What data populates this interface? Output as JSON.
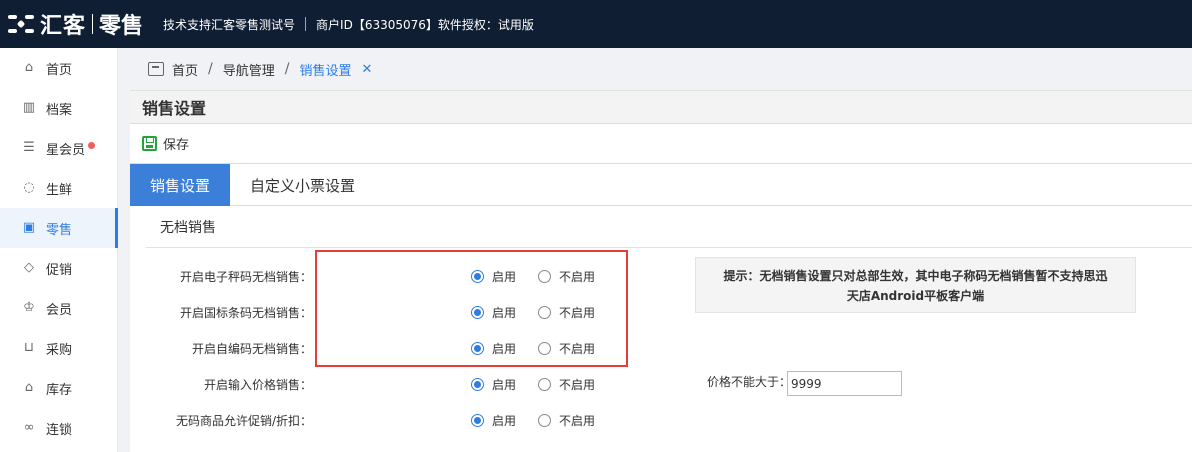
{
  "topbar": {
    "brand": "汇客",
    "product": "零售",
    "support": "技术支持汇客零售测试号",
    "merchant": "商户ID【63305076】软件授权：试用版"
  },
  "sidebar": {
    "items": [
      {
        "label": "首页",
        "icon": "home-icon"
      },
      {
        "label": "档案",
        "icon": "archive-icon"
      },
      {
        "label": "星会员",
        "icon": "star-member-icon",
        "badge": true
      },
      {
        "label": "生鲜",
        "icon": "apple-icon"
      },
      {
        "label": "零售",
        "icon": "bag-icon",
        "active": true
      },
      {
        "label": "促销",
        "icon": "tag-icon"
      },
      {
        "label": "会员",
        "icon": "crown-icon"
      },
      {
        "label": "采购",
        "icon": "cart-icon"
      },
      {
        "label": "库存",
        "icon": "warehouse-icon"
      },
      {
        "label": "连锁",
        "icon": "chain-icon"
      }
    ]
  },
  "breadcrumb": {
    "home": "首页",
    "sep": "/",
    "nav": "导航管理",
    "current": "销售设置",
    "close": "✕"
  },
  "panel": {
    "title": "销售设置",
    "save": "保存"
  },
  "tabs": [
    {
      "label": "销售设置",
      "active": true
    },
    {
      "label": "自定义小票设置",
      "active": false
    }
  ],
  "section": {
    "title": "无档销售"
  },
  "form": {
    "on_label": "启用",
    "off_label": "不启用",
    "rows": [
      {
        "label": "开启电子秤码无档销售：",
        "value": "on"
      },
      {
        "label": "开启国标条码无档销售：",
        "value": "on"
      },
      {
        "label": "开启自编码无档销售：",
        "value": "on"
      },
      {
        "label": "开启输入价格销售：",
        "value": "on"
      },
      {
        "label": "无码商品允许促销/折扣：",
        "value": "on"
      }
    ],
    "price_label": "价格不能大于：",
    "price_value": "9999"
  },
  "tip": {
    "line1": "提示：无档销售设置只对总部生效，其中电子称码无档销售暂不支持思迅",
    "line2": "天店Android平板客户端"
  },
  "colors": {
    "topbar": "#0f1e33",
    "accent": "#2e7de1",
    "tab_active": "#3c7fd8",
    "highlight_box": "#e53c3c",
    "save_green": "#22a33b"
  }
}
